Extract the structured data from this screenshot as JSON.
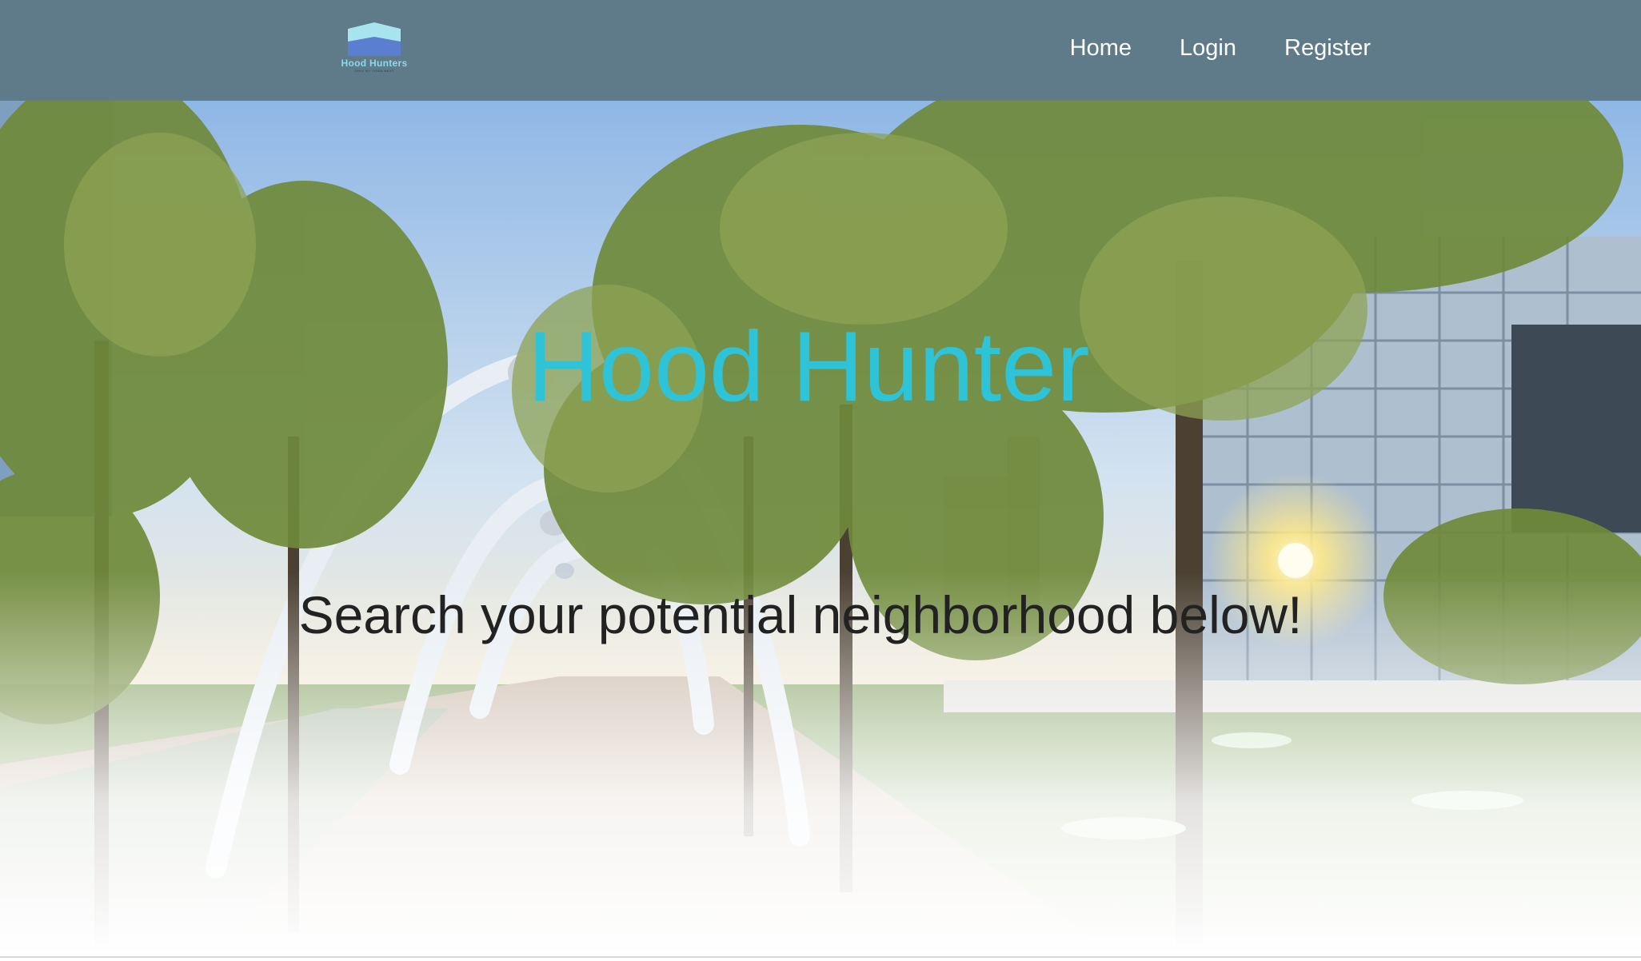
{
  "navbar": {
    "brand": {
      "name": "Hood Hunters",
      "tagline": "SEEK MY TOWN NEXT",
      "logo_icon": "house-roof-icon"
    },
    "links": [
      {
        "label": "Home"
      },
      {
        "label": "Login"
      },
      {
        "label": "Register"
      }
    ]
  },
  "hero": {
    "title": "Hood Hunter",
    "subtitle": "Search your potential neighborhood below!",
    "background_image": "city-park-photo"
  },
  "colors": {
    "navbar_bg": "#5f7b89",
    "title": "#2ec3d6",
    "subtitle": "#222222",
    "nav_text": "#ffffff"
  }
}
